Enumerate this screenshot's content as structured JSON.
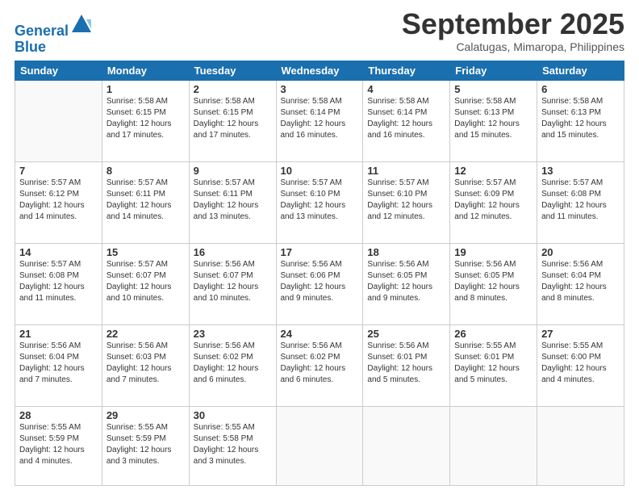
{
  "header": {
    "logo_line1": "General",
    "logo_line2": "Blue",
    "month": "September 2025",
    "location": "Calatugas, Mimaropa, Philippines"
  },
  "days_of_week": [
    "Sunday",
    "Monday",
    "Tuesday",
    "Wednesday",
    "Thursday",
    "Friday",
    "Saturday"
  ],
  "weeks": [
    [
      {
        "day": "",
        "info": ""
      },
      {
        "day": "1",
        "info": "Sunrise: 5:58 AM\nSunset: 6:15 PM\nDaylight: 12 hours\nand 17 minutes."
      },
      {
        "day": "2",
        "info": "Sunrise: 5:58 AM\nSunset: 6:15 PM\nDaylight: 12 hours\nand 17 minutes."
      },
      {
        "day": "3",
        "info": "Sunrise: 5:58 AM\nSunset: 6:14 PM\nDaylight: 12 hours\nand 16 minutes."
      },
      {
        "day": "4",
        "info": "Sunrise: 5:58 AM\nSunset: 6:14 PM\nDaylight: 12 hours\nand 16 minutes."
      },
      {
        "day": "5",
        "info": "Sunrise: 5:58 AM\nSunset: 6:13 PM\nDaylight: 12 hours\nand 15 minutes."
      },
      {
        "day": "6",
        "info": "Sunrise: 5:58 AM\nSunset: 6:13 PM\nDaylight: 12 hours\nand 15 minutes."
      }
    ],
    [
      {
        "day": "7",
        "info": "Sunrise: 5:57 AM\nSunset: 6:12 PM\nDaylight: 12 hours\nand 14 minutes."
      },
      {
        "day": "8",
        "info": "Sunrise: 5:57 AM\nSunset: 6:11 PM\nDaylight: 12 hours\nand 14 minutes."
      },
      {
        "day": "9",
        "info": "Sunrise: 5:57 AM\nSunset: 6:11 PM\nDaylight: 12 hours\nand 13 minutes."
      },
      {
        "day": "10",
        "info": "Sunrise: 5:57 AM\nSunset: 6:10 PM\nDaylight: 12 hours\nand 13 minutes."
      },
      {
        "day": "11",
        "info": "Sunrise: 5:57 AM\nSunset: 6:10 PM\nDaylight: 12 hours\nand 12 minutes."
      },
      {
        "day": "12",
        "info": "Sunrise: 5:57 AM\nSunset: 6:09 PM\nDaylight: 12 hours\nand 12 minutes."
      },
      {
        "day": "13",
        "info": "Sunrise: 5:57 AM\nSunset: 6:08 PM\nDaylight: 12 hours\nand 11 minutes."
      }
    ],
    [
      {
        "day": "14",
        "info": "Sunrise: 5:57 AM\nSunset: 6:08 PM\nDaylight: 12 hours\nand 11 minutes."
      },
      {
        "day": "15",
        "info": "Sunrise: 5:57 AM\nSunset: 6:07 PM\nDaylight: 12 hours\nand 10 minutes."
      },
      {
        "day": "16",
        "info": "Sunrise: 5:56 AM\nSunset: 6:07 PM\nDaylight: 12 hours\nand 10 minutes."
      },
      {
        "day": "17",
        "info": "Sunrise: 5:56 AM\nSunset: 6:06 PM\nDaylight: 12 hours\nand 9 minutes."
      },
      {
        "day": "18",
        "info": "Sunrise: 5:56 AM\nSunset: 6:05 PM\nDaylight: 12 hours\nand 9 minutes."
      },
      {
        "day": "19",
        "info": "Sunrise: 5:56 AM\nSunset: 6:05 PM\nDaylight: 12 hours\nand 8 minutes."
      },
      {
        "day": "20",
        "info": "Sunrise: 5:56 AM\nSunset: 6:04 PM\nDaylight: 12 hours\nand 8 minutes."
      }
    ],
    [
      {
        "day": "21",
        "info": "Sunrise: 5:56 AM\nSunset: 6:04 PM\nDaylight: 12 hours\nand 7 minutes."
      },
      {
        "day": "22",
        "info": "Sunrise: 5:56 AM\nSunset: 6:03 PM\nDaylight: 12 hours\nand 7 minutes."
      },
      {
        "day": "23",
        "info": "Sunrise: 5:56 AM\nSunset: 6:02 PM\nDaylight: 12 hours\nand 6 minutes."
      },
      {
        "day": "24",
        "info": "Sunrise: 5:56 AM\nSunset: 6:02 PM\nDaylight: 12 hours\nand 6 minutes."
      },
      {
        "day": "25",
        "info": "Sunrise: 5:56 AM\nSunset: 6:01 PM\nDaylight: 12 hours\nand 5 minutes."
      },
      {
        "day": "26",
        "info": "Sunrise: 5:55 AM\nSunset: 6:01 PM\nDaylight: 12 hours\nand 5 minutes."
      },
      {
        "day": "27",
        "info": "Sunrise: 5:55 AM\nSunset: 6:00 PM\nDaylight: 12 hours\nand 4 minutes."
      }
    ],
    [
      {
        "day": "28",
        "info": "Sunrise: 5:55 AM\nSunset: 5:59 PM\nDaylight: 12 hours\nand 4 minutes."
      },
      {
        "day": "29",
        "info": "Sunrise: 5:55 AM\nSunset: 5:59 PM\nDaylight: 12 hours\nand 3 minutes."
      },
      {
        "day": "30",
        "info": "Sunrise: 5:55 AM\nSunset: 5:58 PM\nDaylight: 12 hours\nand 3 minutes."
      },
      {
        "day": "",
        "info": ""
      },
      {
        "day": "",
        "info": ""
      },
      {
        "day": "",
        "info": ""
      },
      {
        "day": "",
        "info": ""
      }
    ]
  ]
}
